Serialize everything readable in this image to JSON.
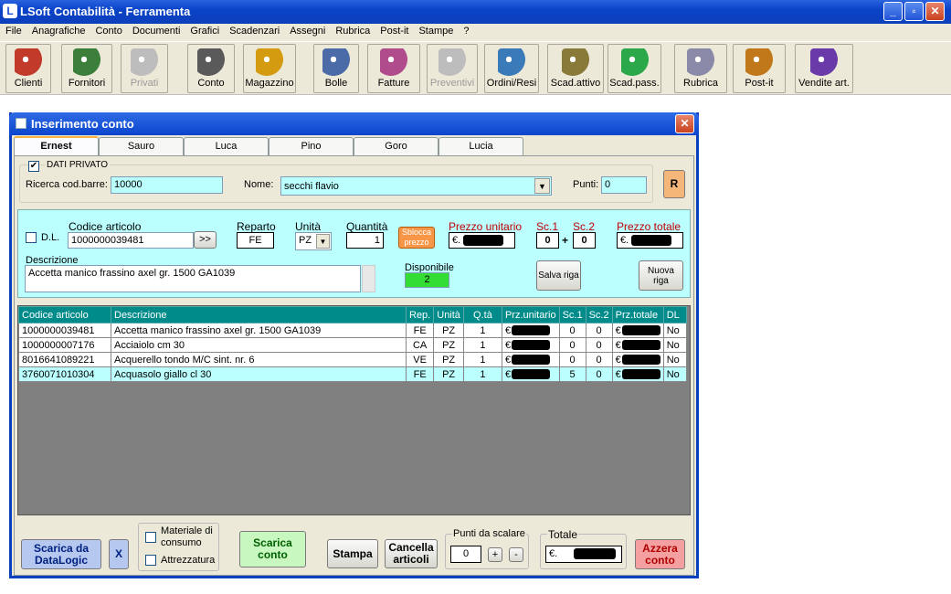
{
  "app": {
    "title": "LSoft Contabilità - Ferramenta",
    "icon": "lsoft-logo-icon"
  },
  "window_controls": {
    "min": "_",
    "max": "▫",
    "close": "✕"
  },
  "menu": [
    "File",
    "Anagrafiche",
    "Conto",
    "Documenti",
    "Grafici",
    "Scadenzari",
    "Assegni",
    "Rubrica",
    "Post-it",
    "Stampe",
    "?"
  ],
  "toolbar": [
    {
      "label": "Clienti",
      "icon": "client-icon",
      "color": "#c23a2a",
      "enabled": true
    },
    {
      "label": "Fornitori",
      "icon": "supplier-icon",
      "color": "#3b7f3b",
      "enabled": true
    },
    {
      "label": "Privati",
      "icon": "private-users-icon",
      "color": "#bdbdbd",
      "enabled": false
    },
    {
      "label": "Conto",
      "icon": "cash-register-icon",
      "color": "#5a5a5a",
      "enabled": true
    },
    {
      "label": "Magazzino",
      "icon": "forklift-icon",
      "color": "#d49a10",
      "enabled": true
    },
    {
      "label": "Bolle",
      "icon": "delivery-note-icon",
      "color": "#4a6aa8",
      "enabled": true
    },
    {
      "label": "Fatture",
      "icon": "invoice-icon",
      "color": "#b04c8c",
      "enabled": true
    },
    {
      "label": "Preventivi",
      "icon": "quote-icon",
      "color": "#bdbdbd",
      "enabled": false
    },
    {
      "label": "Ordini/Resi",
      "icon": "truck-icon",
      "color": "#3a7ab8",
      "enabled": true
    },
    {
      "label": "Scad.attivo",
      "icon": "receivables-icon",
      "color": "#8a7a3a",
      "enabled": true
    },
    {
      "label": "Scad.pass.",
      "icon": "payables-icon",
      "color": "#2aa84a",
      "enabled": true
    },
    {
      "label": "Rubrica",
      "icon": "address-book-icon",
      "color": "#8a8aa8",
      "enabled": true
    },
    {
      "label": "Post-it",
      "icon": "postit-icon",
      "color": "#c0781a",
      "enabled": true
    },
    {
      "label": "Vendite art.",
      "icon": "sales-chart-icon",
      "color": "#6a3aa8",
      "enabled": true
    }
  ],
  "dialog": {
    "title": "Inserimento conto",
    "tabs": [
      "Ernest",
      "Sauro",
      "Luca",
      "Pino",
      "Goro",
      "Lucia"
    ],
    "selected_tab": "Ernest",
    "private": {
      "checkbox_label": "DATI PRIVATO",
      "checked": true,
      "barcode_label": "Ricerca cod.barre:",
      "barcode_value": "10000",
      "name_label": "Nome:",
      "name_value": "secchi flavio",
      "points_label": "Punti:",
      "points_value": "0",
      "r_button": "R"
    },
    "entry": {
      "dl_label": "D.L.",
      "code_label": "Codice articolo",
      "code_value": "1000000039481",
      "browse": ">>",
      "dept_label": "Reparto",
      "dept_value": "FE",
      "unit_label": "Unità",
      "unit_value": "PZ",
      "qty_label": "Quantità",
      "qty_value": "1",
      "unlock_label": "Sblocca prezzo",
      "unit_price_label": "Prezzo unitario",
      "currency": "€.",
      "sc1_label": "Sc.1",
      "sc1_value": "0",
      "plus": "+",
      "sc2_label": "Sc.2",
      "sc2_value": "0",
      "total_price_label": "Prezzo totale",
      "desc_label": "Descrizione",
      "desc_value": "Accetta manico frassino axel gr. 1500 GA1039",
      "available_label": "Disponibile",
      "available_value": "2",
      "save_row": "Salva riga",
      "new_row": "Nuova riga"
    },
    "grid": {
      "columns": [
        "Codice articolo",
        "Descrizione",
        "Rep.",
        "Unità",
        "Q.tà",
        "Prz.unitario",
        "Sc.1",
        "Sc.2",
        "Prz.totale",
        "DL"
      ],
      "rows": [
        [
          "1000000039481",
          "Accetta manico frassino axel gr. 1500 GA1039",
          "FE",
          "PZ",
          "1",
          "€",
          "0",
          "0",
          "€",
          "No"
        ],
        [
          "1000000007176",
          "Acciaiolo cm 30",
          "CA",
          "PZ",
          "1",
          "€",
          "0",
          "0",
          "€",
          "No"
        ],
        [
          "8016641089221",
          "Acquerello tondo M/C  sint. nr. 6",
          "VE",
          "PZ",
          "1",
          "€",
          "0",
          "0",
          "€",
          "No"
        ],
        [
          "3760071010304",
          "Acquasolo giallo cl 30",
          "FE",
          "PZ",
          "1",
          "€",
          "5",
          "0",
          "€",
          "No"
        ]
      ]
    },
    "bottom": {
      "datalogic": "Scarica da DataLogic",
      "x": "X",
      "consumables": "Materiale di consumo",
      "equipment": "Attrezzatura",
      "unload": "Scarica conto",
      "print": "Stampa",
      "delete": "Cancella articoli",
      "points_group": "Punti da scalare",
      "points_value": "0",
      "plus": "+",
      "minus": "-",
      "total_group": "Totale",
      "total_currency": "€.",
      "reset": "Azzera conto"
    }
  }
}
